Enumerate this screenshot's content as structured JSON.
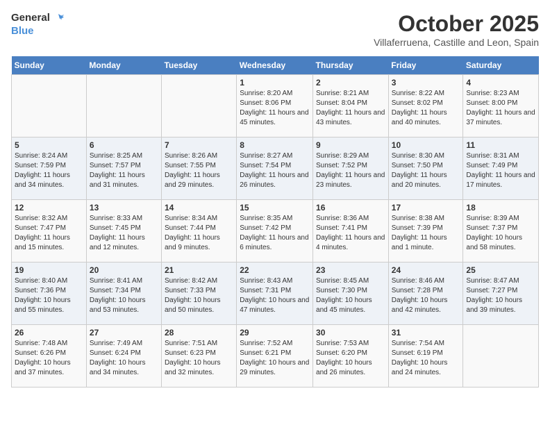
{
  "header": {
    "logo_general": "General",
    "logo_blue": "Blue",
    "title": "October 2025",
    "subtitle": "Villaferruena, Castille and Leon, Spain"
  },
  "days_of_week": [
    "Sunday",
    "Monday",
    "Tuesday",
    "Wednesday",
    "Thursday",
    "Friday",
    "Saturday"
  ],
  "weeks": [
    [
      {
        "day": "",
        "info": ""
      },
      {
        "day": "",
        "info": ""
      },
      {
        "day": "",
        "info": ""
      },
      {
        "day": "1",
        "info": "Sunrise: 8:20 AM\nSunset: 8:06 PM\nDaylight: 11 hours and 45 minutes."
      },
      {
        "day": "2",
        "info": "Sunrise: 8:21 AM\nSunset: 8:04 PM\nDaylight: 11 hours and 43 minutes."
      },
      {
        "day": "3",
        "info": "Sunrise: 8:22 AM\nSunset: 8:02 PM\nDaylight: 11 hours and 40 minutes."
      },
      {
        "day": "4",
        "info": "Sunrise: 8:23 AM\nSunset: 8:00 PM\nDaylight: 11 hours and 37 minutes."
      }
    ],
    [
      {
        "day": "5",
        "info": "Sunrise: 8:24 AM\nSunset: 7:59 PM\nDaylight: 11 hours and 34 minutes."
      },
      {
        "day": "6",
        "info": "Sunrise: 8:25 AM\nSunset: 7:57 PM\nDaylight: 11 hours and 31 minutes."
      },
      {
        "day": "7",
        "info": "Sunrise: 8:26 AM\nSunset: 7:55 PM\nDaylight: 11 hours and 29 minutes."
      },
      {
        "day": "8",
        "info": "Sunrise: 8:27 AM\nSunset: 7:54 PM\nDaylight: 11 hours and 26 minutes."
      },
      {
        "day": "9",
        "info": "Sunrise: 8:29 AM\nSunset: 7:52 PM\nDaylight: 11 hours and 23 minutes."
      },
      {
        "day": "10",
        "info": "Sunrise: 8:30 AM\nSunset: 7:50 PM\nDaylight: 11 hours and 20 minutes."
      },
      {
        "day": "11",
        "info": "Sunrise: 8:31 AM\nSunset: 7:49 PM\nDaylight: 11 hours and 17 minutes."
      }
    ],
    [
      {
        "day": "12",
        "info": "Sunrise: 8:32 AM\nSunset: 7:47 PM\nDaylight: 11 hours and 15 minutes."
      },
      {
        "day": "13",
        "info": "Sunrise: 8:33 AM\nSunset: 7:45 PM\nDaylight: 11 hours and 12 minutes."
      },
      {
        "day": "14",
        "info": "Sunrise: 8:34 AM\nSunset: 7:44 PM\nDaylight: 11 hours and 9 minutes."
      },
      {
        "day": "15",
        "info": "Sunrise: 8:35 AM\nSunset: 7:42 PM\nDaylight: 11 hours and 6 minutes."
      },
      {
        "day": "16",
        "info": "Sunrise: 8:36 AM\nSunset: 7:41 PM\nDaylight: 11 hours and 4 minutes."
      },
      {
        "day": "17",
        "info": "Sunrise: 8:38 AM\nSunset: 7:39 PM\nDaylight: 11 hours and 1 minute."
      },
      {
        "day": "18",
        "info": "Sunrise: 8:39 AM\nSunset: 7:37 PM\nDaylight: 10 hours and 58 minutes."
      }
    ],
    [
      {
        "day": "19",
        "info": "Sunrise: 8:40 AM\nSunset: 7:36 PM\nDaylight: 10 hours and 55 minutes."
      },
      {
        "day": "20",
        "info": "Sunrise: 8:41 AM\nSunset: 7:34 PM\nDaylight: 10 hours and 53 minutes."
      },
      {
        "day": "21",
        "info": "Sunrise: 8:42 AM\nSunset: 7:33 PM\nDaylight: 10 hours and 50 minutes."
      },
      {
        "day": "22",
        "info": "Sunrise: 8:43 AM\nSunset: 7:31 PM\nDaylight: 10 hours and 47 minutes."
      },
      {
        "day": "23",
        "info": "Sunrise: 8:45 AM\nSunset: 7:30 PM\nDaylight: 10 hours and 45 minutes."
      },
      {
        "day": "24",
        "info": "Sunrise: 8:46 AM\nSunset: 7:28 PM\nDaylight: 10 hours and 42 minutes."
      },
      {
        "day": "25",
        "info": "Sunrise: 8:47 AM\nSunset: 7:27 PM\nDaylight: 10 hours and 39 minutes."
      }
    ],
    [
      {
        "day": "26",
        "info": "Sunrise: 7:48 AM\nSunset: 6:26 PM\nDaylight: 10 hours and 37 minutes."
      },
      {
        "day": "27",
        "info": "Sunrise: 7:49 AM\nSunset: 6:24 PM\nDaylight: 10 hours and 34 minutes."
      },
      {
        "day": "28",
        "info": "Sunrise: 7:51 AM\nSunset: 6:23 PM\nDaylight: 10 hours and 32 minutes."
      },
      {
        "day": "29",
        "info": "Sunrise: 7:52 AM\nSunset: 6:21 PM\nDaylight: 10 hours and 29 minutes."
      },
      {
        "day": "30",
        "info": "Sunrise: 7:53 AM\nSunset: 6:20 PM\nDaylight: 10 hours and 26 minutes."
      },
      {
        "day": "31",
        "info": "Sunrise: 7:54 AM\nSunset: 6:19 PM\nDaylight: 10 hours and 24 minutes."
      },
      {
        "day": "",
        "info": ""
      }
    ]
  ]
}
